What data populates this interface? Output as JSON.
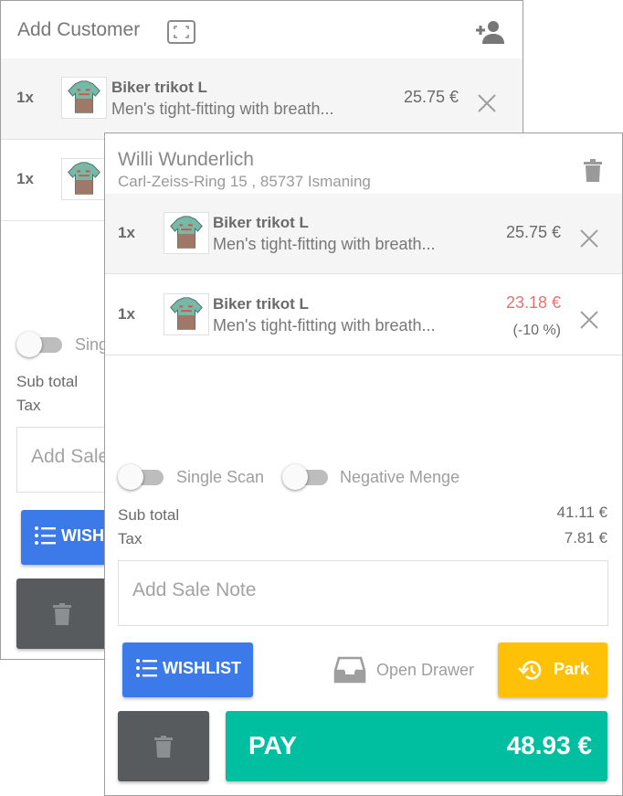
{
  "back_panel": {
    "title": "Add Customer",
    "items": [
      {
        "qty": "1x",
        "name": "Biker trikot L",
        "desc": "Men's tight-fitting with breath...",
        "price": "25.75 €"
      },
      {
        "qty": "1x"
      }
    ],
    "toggle_label": "Sing",
    "subtotal_label": "Sub total",
    "tax_label": "Tax",
    "note_placeholder": "Add Sale",
    "wishlist_label": "WISH"
  },
  "front_panel": {
    "customer_name": "Willi Wunderlich",
    "customer_address": "Carl-Zeiss-Ring 15 , 85737 Ismaning",
    "items": [
      {
        "qty": "1x",
        "name": "Biker trikot L",
        "desc": "Men's tight-fitting with breath...",
        "price": "25.75 €"
      },
      {
        "qty": "1x",
        "name": "Biker trikot L",
        "desc": "Men's tight-fitting with breath...",
        "price": "23.18 €",
        "discount": "(-10 %)"
      }
    ],
    "toggles": [
      {
        "label": "Single Scan",
        "on": false
      },
      {
        "label": "Negative Menge",
        "on": false
      }
    ],
    "subtotal_label": "Sub total",
    "subtotal_value": "41.11 €",
    "tax_label": "Tax",
    "tax_value": "7.81 €",
    "note_placeholder": "Add Sale Note",
    "wishlist_label": "WISHLIST",
    "open_drawer_label": "Open Drawer",
    "park_label": "Park",
    "pay_label": "PAY",
    "pay_amount": "48.93 €"
  },
  "colors": {
    "wishlist_blue": "#3b7ae8",
    "pay_green": "#00bfa0",
    "park_yellow": "#ffc107",
    "trash_gray": "#575b5e",
    "discount_red": "#e57373"
  },
  "icons": [
    "expand-icon",
    "add-person-icon",
    "close-icon",
    "trash-icon",
    "list-icon",
    "inbox-tray-icon",
    "history-icon"
  ]
}
